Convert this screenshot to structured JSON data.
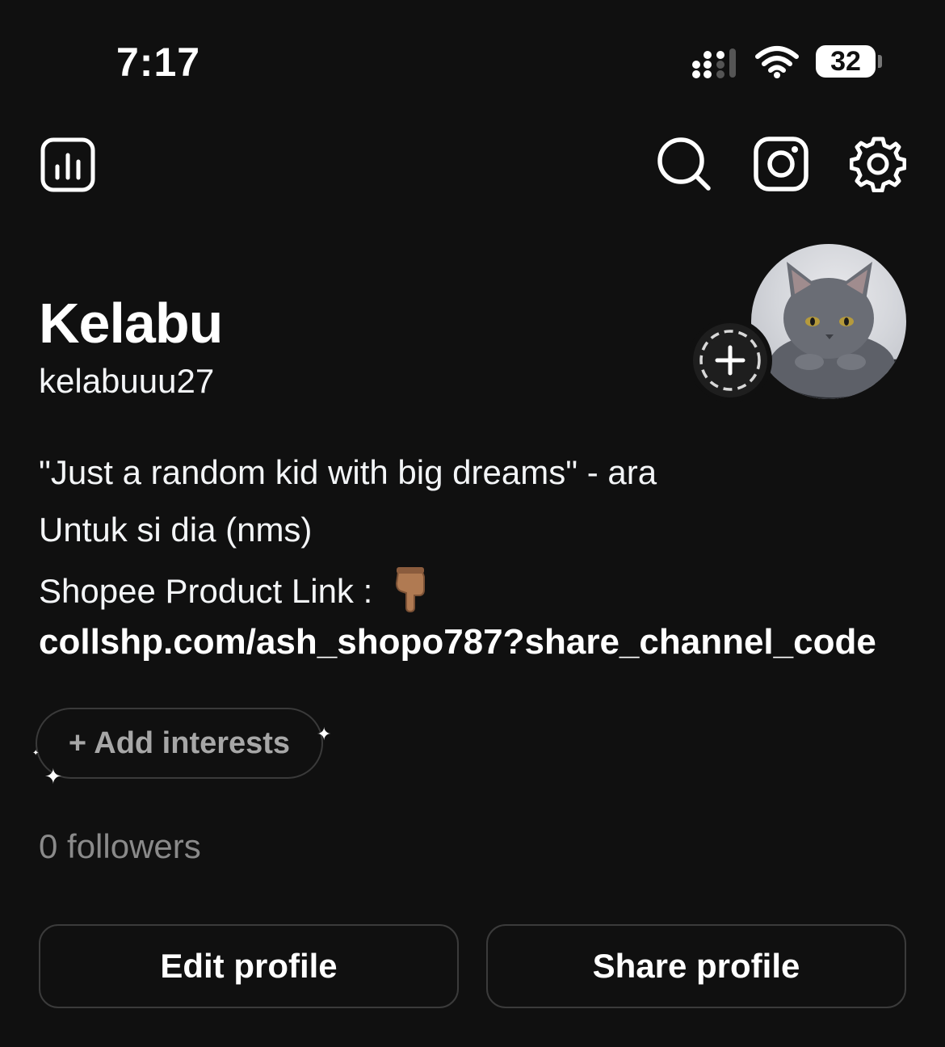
{
  "status_bar": {
    "time": "7:17",
    "battery": "32",
    "signal_icon": "cellular-signal-icon",
    "wifi_icon": "wifi-icon"
  },
  "toolbar": {
    "left_icon": "insights-bar-chart-icon",
    "right_icons": [
      "search-icon",
      "instagram-icon",
      "settings-gear-icon"
    ]
  },
  "profile": {
    "display_name": "Kelabu",
    "username": "kelabuuu27",
    "avatar_icon": "grey-cat-photo",
    "add_story_icon": "plus-icon",
    "bio": [
      "\"Just a random kid with big dreams\" - ara",
      "Untuk si dia (nms)",
      "Shopee Product Link :"
    ],
    "bio_emoji_icon": "pointing-down-hand-icon",
    "link": "collshp.com/ash_shopo787?share_channel_code",
    "add_interests": "+ Add interests",
    "followers": "0 followers"
  },
  "actions": {
    "edit": "Edit profile",
    "share": "Share profile"
  },
  "colors": {
    "background": "#101010",
    "text": "#f3f5f7",
    "muted": "#8a8a8a",
    "border": "#3b3b3b"
  }
}
